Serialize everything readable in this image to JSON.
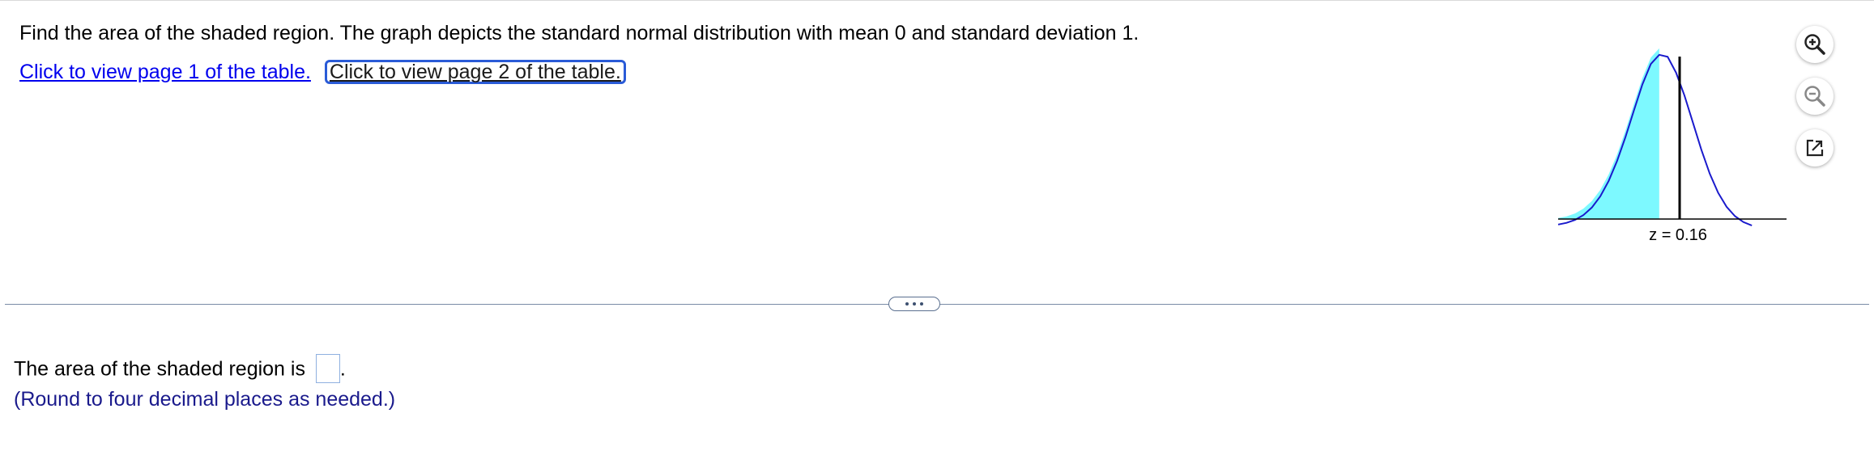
{
  "question": {
    "text": "Find the area of the shaded region. The graph depicts the standard normal distribution with mean 0 and standard deviation 1."
  },
  "links": {
    "page1": "Click to view page 1 of the table.",
    "page2": "Click to view page 2 of the table."
  },
  "graph": {
    "z_label": "z = 0.16",
    "z_value": 0.16,
    "shaded_side": "left",
    "colors": {
      "fill": "#7df9ff",
      "curve": "#1a1acc",
      "line": "#000000"
    }
  },
  "tools": {
    "zoom_in": "zoom-in-icon",
    "zoom_out": "zoom-out-icon",
    "popout": "popout-icon"
  },
  "answer": {
    "prompt": "The area of the shaded region is",
    "period": ".",
    "input_value": "",
    "hint": "(Round to four decimal places as needed.)"
  }
}
